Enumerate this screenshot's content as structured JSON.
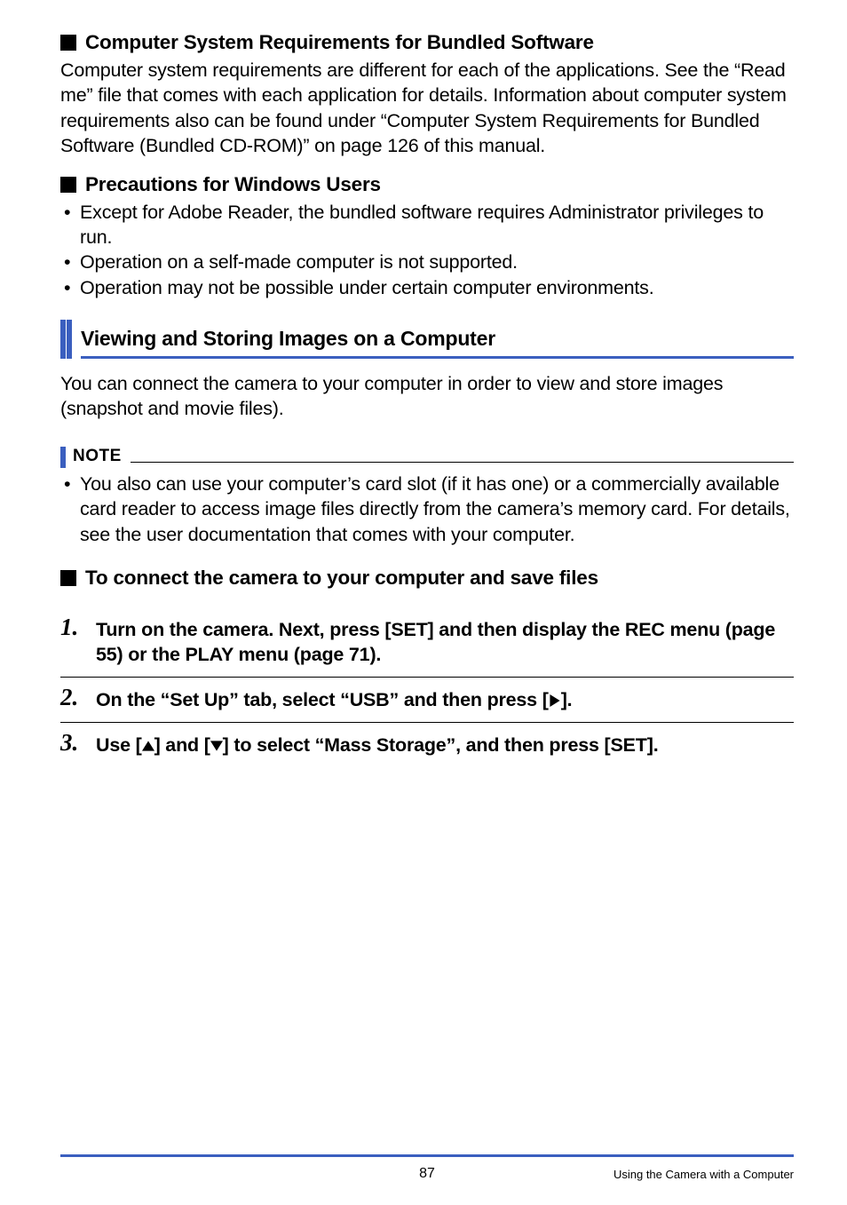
{
  "h1": {
    "title": "Computer System Requirements for Bundled Software",
    "para": "Computer system requirements are different for each of the applications. See the “Read me” file that comes with each application for details. Information about computer system requirements also can be found under “Computer System Requirements for Bundled Software (Bundled CD-ROM)” on page 126 of this manual."
  },
  "h2": {
    "title": "Precautions for Windows Users",
    "items": [
      "Except for Adobe Reader, the bundled software requires Administrator privileges to run.",
      "Operation on a self-made computer is not supported.",
      "Operation may not be possible under certain computer environments."
    ]
  },
  "section": {
    "title": "Viewing and Storing Images on a Computer",
    "para": "You can connect the camera to your computer in order to view and store images (snapshot and movie files)."
  },
  "note": {
    "label": "NOTE",
    "items": [
      "You also can use your computer’s card slot (if it has one) or a commercially available card reader to access image files directly from the camera’s memory card. For details, see the user documentation that comes with your computer."
    ]
  },
  "h3": {
    "title": "To connect the camera to your computer and save files"
  },
  "steps": {
    "s1": {
      "num": "1.",
      "body": "Turn on the camera. Next, press [SET] and then display the REC menu (page 55) or the PLAY menu (page 71)."
    },
    "s2": {
      "num": "2.",
      "pre": "On the “Set Up” tab, select “USB” and then press [",
      "post": "]."
    },
    "s3": {
      "num": "3.",
      "pre": "Use [",
      "mid": "] and [",
      "post": "] to select “Mass Storage”, and then press [SET]."
    }
  },
  "footer": {
    "page": "87",
    "caption": "Using the Camera with a Computer"
  }
}
